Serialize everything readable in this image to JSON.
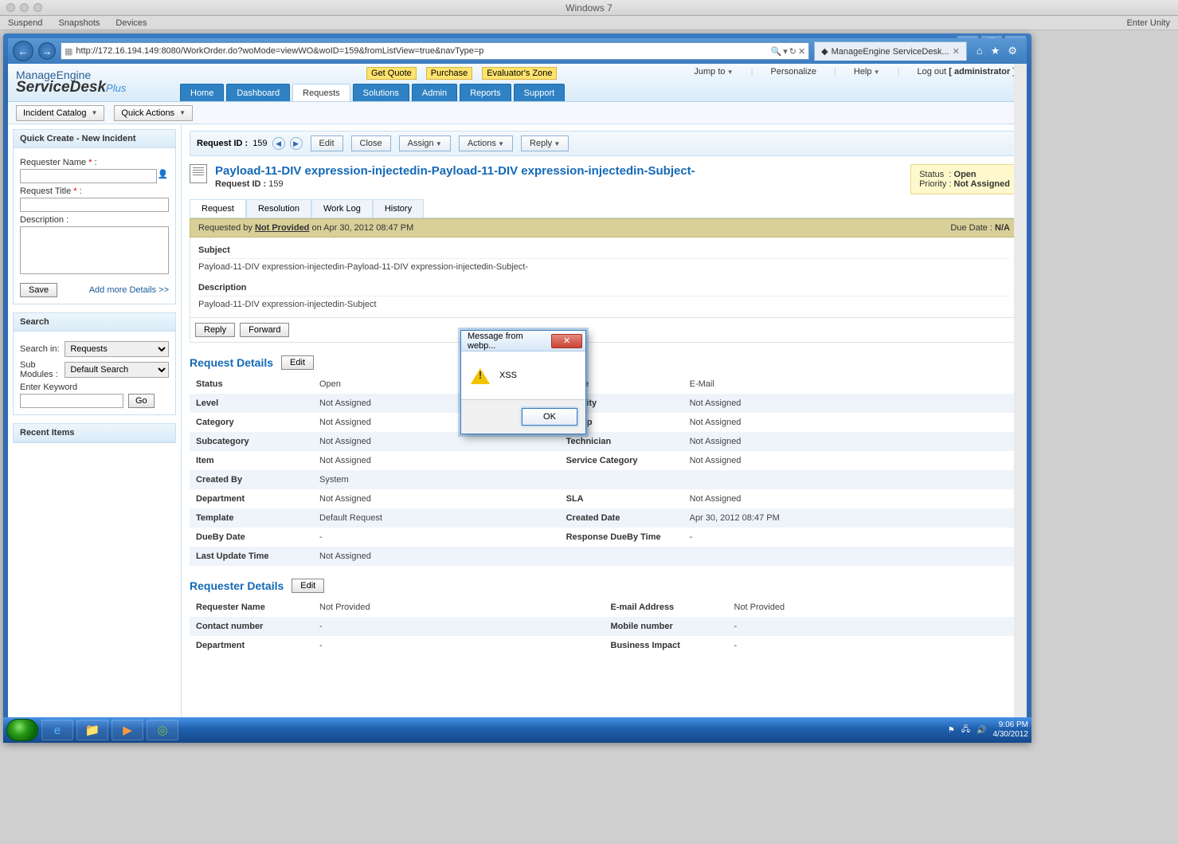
{
  "mac": {
    "title": "Windows 7",
    "menu": [
      "Suspend",
      "Snapshots",
      "Devices"
    ],
    "right": "Enter Unity"
  },
  "ie": {
    "url": "http://172.16.194.149:8080/WorkOrder.do?woMode=viewWO&woID=159&fromListView=true&navType=p",
    "tab": "ManageEngine ServiceDesk..."
  },
  "app": {
    "logo_top": "ManageEngine",
    "logo_main": "ServiceDesk",
    "logo_plus": "Plus",
    "highlighted": [
      {
        "t": "Get Quote"
      },
      {
        "t": "Purchase"
      },
      {
        "t": "Evaluator's Zone"
      }
    ],
    "top_right": {
      "jump": "Jump to",
      "personalize": "Personalize",
      "help": "Help",
      "logout": "Log out",
      "user": "[ administrator ]"
    },
    "nav": [
      "Home",
      "Dashboard",
      "Requests",
      "Solutions",
      "Admin",
      "Reports",
      "Support"
    ],
    "nav_active": "Requests",
    "sub": {
      "catalog": "Incident Catalog",
      "quick": "Quick Actions"
    }
  },
  "sidebar": {
    "quick_create": {
      "title": "Quick Create - New Incident",
      "requester": "Requester Name",
      "req_title": "Request Title",
      "desc": "Description :",
      "save": "Save",
      "more": "Add more Details >>"
    },
    "search": {
      "title": "Search",
      "in_label": "Search in:",
      "in_val": "Requests",
      "sub_label": "Sub Modules :",
      "sub_val": "Default Search",
      "kw": "Enter Keyword",
      "go": "Go"
    },
    "recent": {
      "title": "Recent Items"
    }
  },
  "request": {
    "bar_label": "Request ID :",
    "bar_id": "159",
    "buttons": {
      "edit": "Edit",
      "close": "Close",
      "assign": "Assign",
      "actions": "Actions",
      "reply": "Reply"
    },
    "title": "Payload-11-DIV expression-injectedin-Payload-11-DIV expression-injectedin-Subject-",
    "sub_label": "Request ID :",
    "sub_id": "159",
    "status_box": {
      "status_l": "Status",
      "status_v": "Open",
      "prio_l": "Priority",
      "prio_v": "Not Assigned"
    },
    "inner_tabs": [
      "Request",
      "Resolution",
      "Work Log",
      "History"
    ],
    "inner_active": "Request",
    "meta": {
      "req_by": "Requested by",
      "name": "Not Provided",
      "on": " on Apr 30, 2012 08:47 PM",
      "due_l": "Due Date :",
      "due_v": "N/A"
    },
    "subject_h": "Subject",
    "subject_v": "Payload-11-DIV expression-injectedin-Payload-11-DIV expression-injectedin-Subject-",
    "desc_h": "Description",
    "desc_v": "Payload-11-DIV expression-injectedin-Subject",
    "reply": "Reply",
    "forward": "Forward",
    "details_h": "Request Details",
    "details_edit": "Edit",
    "rows": [
      {
        "l": "Status",
        "v": "Open",
        "l2": "Mode",
        "v2": "E-Mail"
      },
      {
        "l": "Level",
        "v": "Not Assigned",
        "l2": "Priority",
        "v2": "Not Assigned"
      },
      {
        "l": "Category",
        "v": "Not Assigned",
        "l2": "Group",
        "v2": "Not Assigned"
      },
      {
        "l": "Subcategory",
        "v": "Not Assigned",
        "l2": "Technician",
        "v2": "Not Assigned"
      },
      {
        "l": "Item",
        "v": "Not Assigned",
        "l2": "Service Category",
        "v2": "Not Assigned"
      },
      {
        "l": "Created By",
        "v": "System",
        "l2": "",
        "v2": ""
      },
      {
        "l": "Department",
        "v": "Not Assigned",
        "l2": "SLA",
        "v2": "Not Assigned"
      },
      {
        "l": "Template",
        "v": "Default Request",
        "l2": "Created Date",
        "v2": "Apr 30, 2012 08:47 PM"
      },
      {
        "l": "DueBy Date",
        "v": "-",
        "l2": "Response DueBy Time",
        "v2": "-"
      },
      {
        "l": "Last Update Time",
        "v": "Not Assigned",
        "l2": "",
        "v2": ""
      }
    ],
    "requester_h": "Requester Details",
    "requester_edit": "Edit",
    "rrows": [
      {
        "l": "Requester Name",
        "v": "Not Provided",
        "l2": "E-mail Address",
        "v2": "Not Provided"
      },
      {
        "l": "Contact number",
        "v": "-",
        "l2": "Mobile number",
        "v2": "-"
      },
      {
        "l": "Department",
        "v": "-",
        "l2": "Business Impact",
        "v2": "-"
      }
    ]
  },
  "alert": {
    "title": "Message from webp...",
    "msg": "XSS",
    "ok": "OK"
  },
  "taskbar": {
    "time": "9:06 PM",
    "date": "4/30/2012"
  }
}
